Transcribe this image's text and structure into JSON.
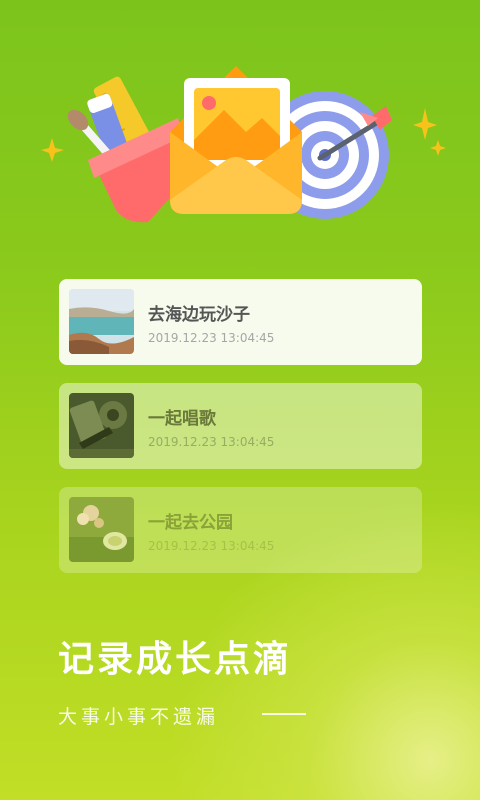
{
  "cards": [
    {
      "title": "去海边玩沙子",
      "date": "2019.12.23 13:04:45",
      "thumb": "beach-photo"
    },
    {
      "title": "一起唱歌",
      "date": "2019.12.23 13:04:45",
      "thumb": "music-photo"
    },
    {
      "title": "一起去公园",
      "date": "2019.12.23 13:04:45",
      "thumb": "park-photo"
    }
  ],
  "slogan": {
    "title": "记录成长点滴",
    "subtitle": "大事小事不遗漏"
  },
  "colors": {
    "background_top": "#7cc41c",
    "background_bottom": "#c2de26",
    "envelope": "#ffa91a",
    "box": "#ff6b6b",
    "target": "#8a9be8"
  }
}
